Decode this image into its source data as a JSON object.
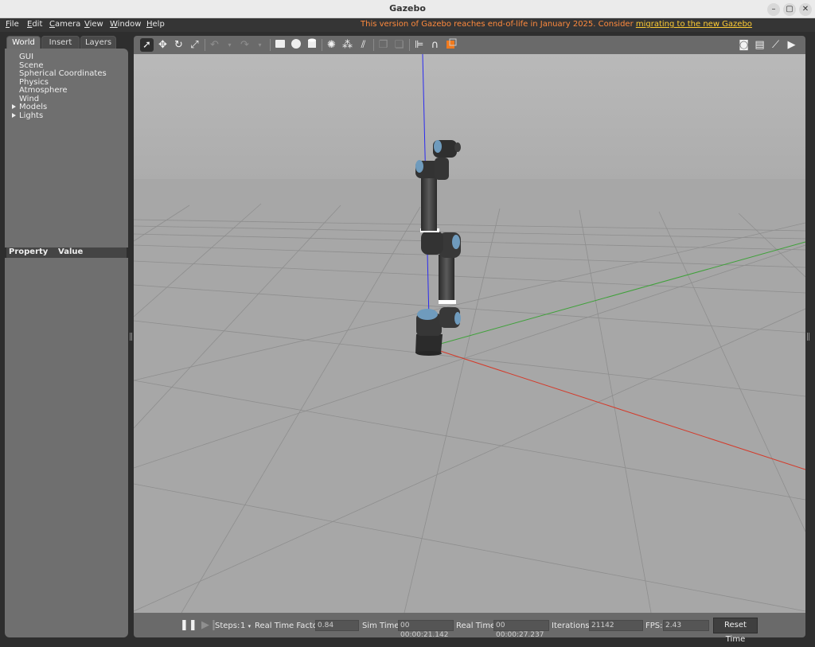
{
  "window": {
    "title": "Gazebo"
  },
  "menu": {
    "file": "ile",
    "file_u": "F",
    "edit": "dit",
    "edit_u": "E",
    "camera": "amera",
    "camera_u": "C",
    "view": "iew",
    "view_u": "V",
    "window": "indow",
    "window_u": "W",
    "help": "elp",
    "help_u": "H"
  },
  "notice": {
    "text": "This version of Gazebo reaches end-of-life in January 2025. Consider ",
    "link": "migrating to the new Gazebo"
  },
  "tabs": [
    "World",
    "Insert",
    "Layers"
  ],
  "world_tree": [
    "GUI",
    "Scene",
    "Spherical Coordinates",
    "Physics",
    "Atmosphere",
    "Wind",
    "Models",
    "Lights"
  ],
  "property_header": {
    "property": "Property",
    "value": "Value"
  },
  "toolbar_icons": [
    "select-arrow-icon",
    "translate-icon",
    "rotate-icon",
    "scale-icon",
    "undo-icon",
    "undo-dropdown-icon",
    "redo-icon",
    "redo-dropdown-icon",
    "box-shape-icon",
    "sphere-shape-icon",
    "cylinder-shape-icon",
    "point-light-icon",
    "spot-light-icon",
    "directional-light-icon",
    "copy-icon",
    "paste-icon",
    "align-icon",
    "snap-icon",
    "view-angle-icon",
    "screenshot-icon",
    "log-icon",
    "plot-icon",
    "video-record-icon"
  ],
  "bottom": {
    "steps_label": "Steps:",
    "steps_value": "1",
    "rtf_label": "Real Time Factor:",
    "rtf_value": "0.84",
    "simtime_label": "Sim Time:",
    "simtime_value": "00 00:00:21.142",
    "realtime_label": "Real Time:",
    "realtime_value": "00 00:00:27.237",
    "iterations_label": "Iterations:",
    "iterations_value": "21142",
    "fps_label": "FPS:",
    "fps_value": "2.43",
    "reset_label": "Reset Time"
  },
  "colors": {
    "notice": "#ff8a3d",
    "link": "#ffcc33",
    "sky": "#b3b3b3",
    "ground": "#a6a6a6",
    "x_axis": "#d43a2a",
    "y_axis": "#3fa13a",
    "z_axis": "#2a2af0",
    "robot": "#3a3a3a",
    "joint_cap": "#6f9bbd"
  }
}
